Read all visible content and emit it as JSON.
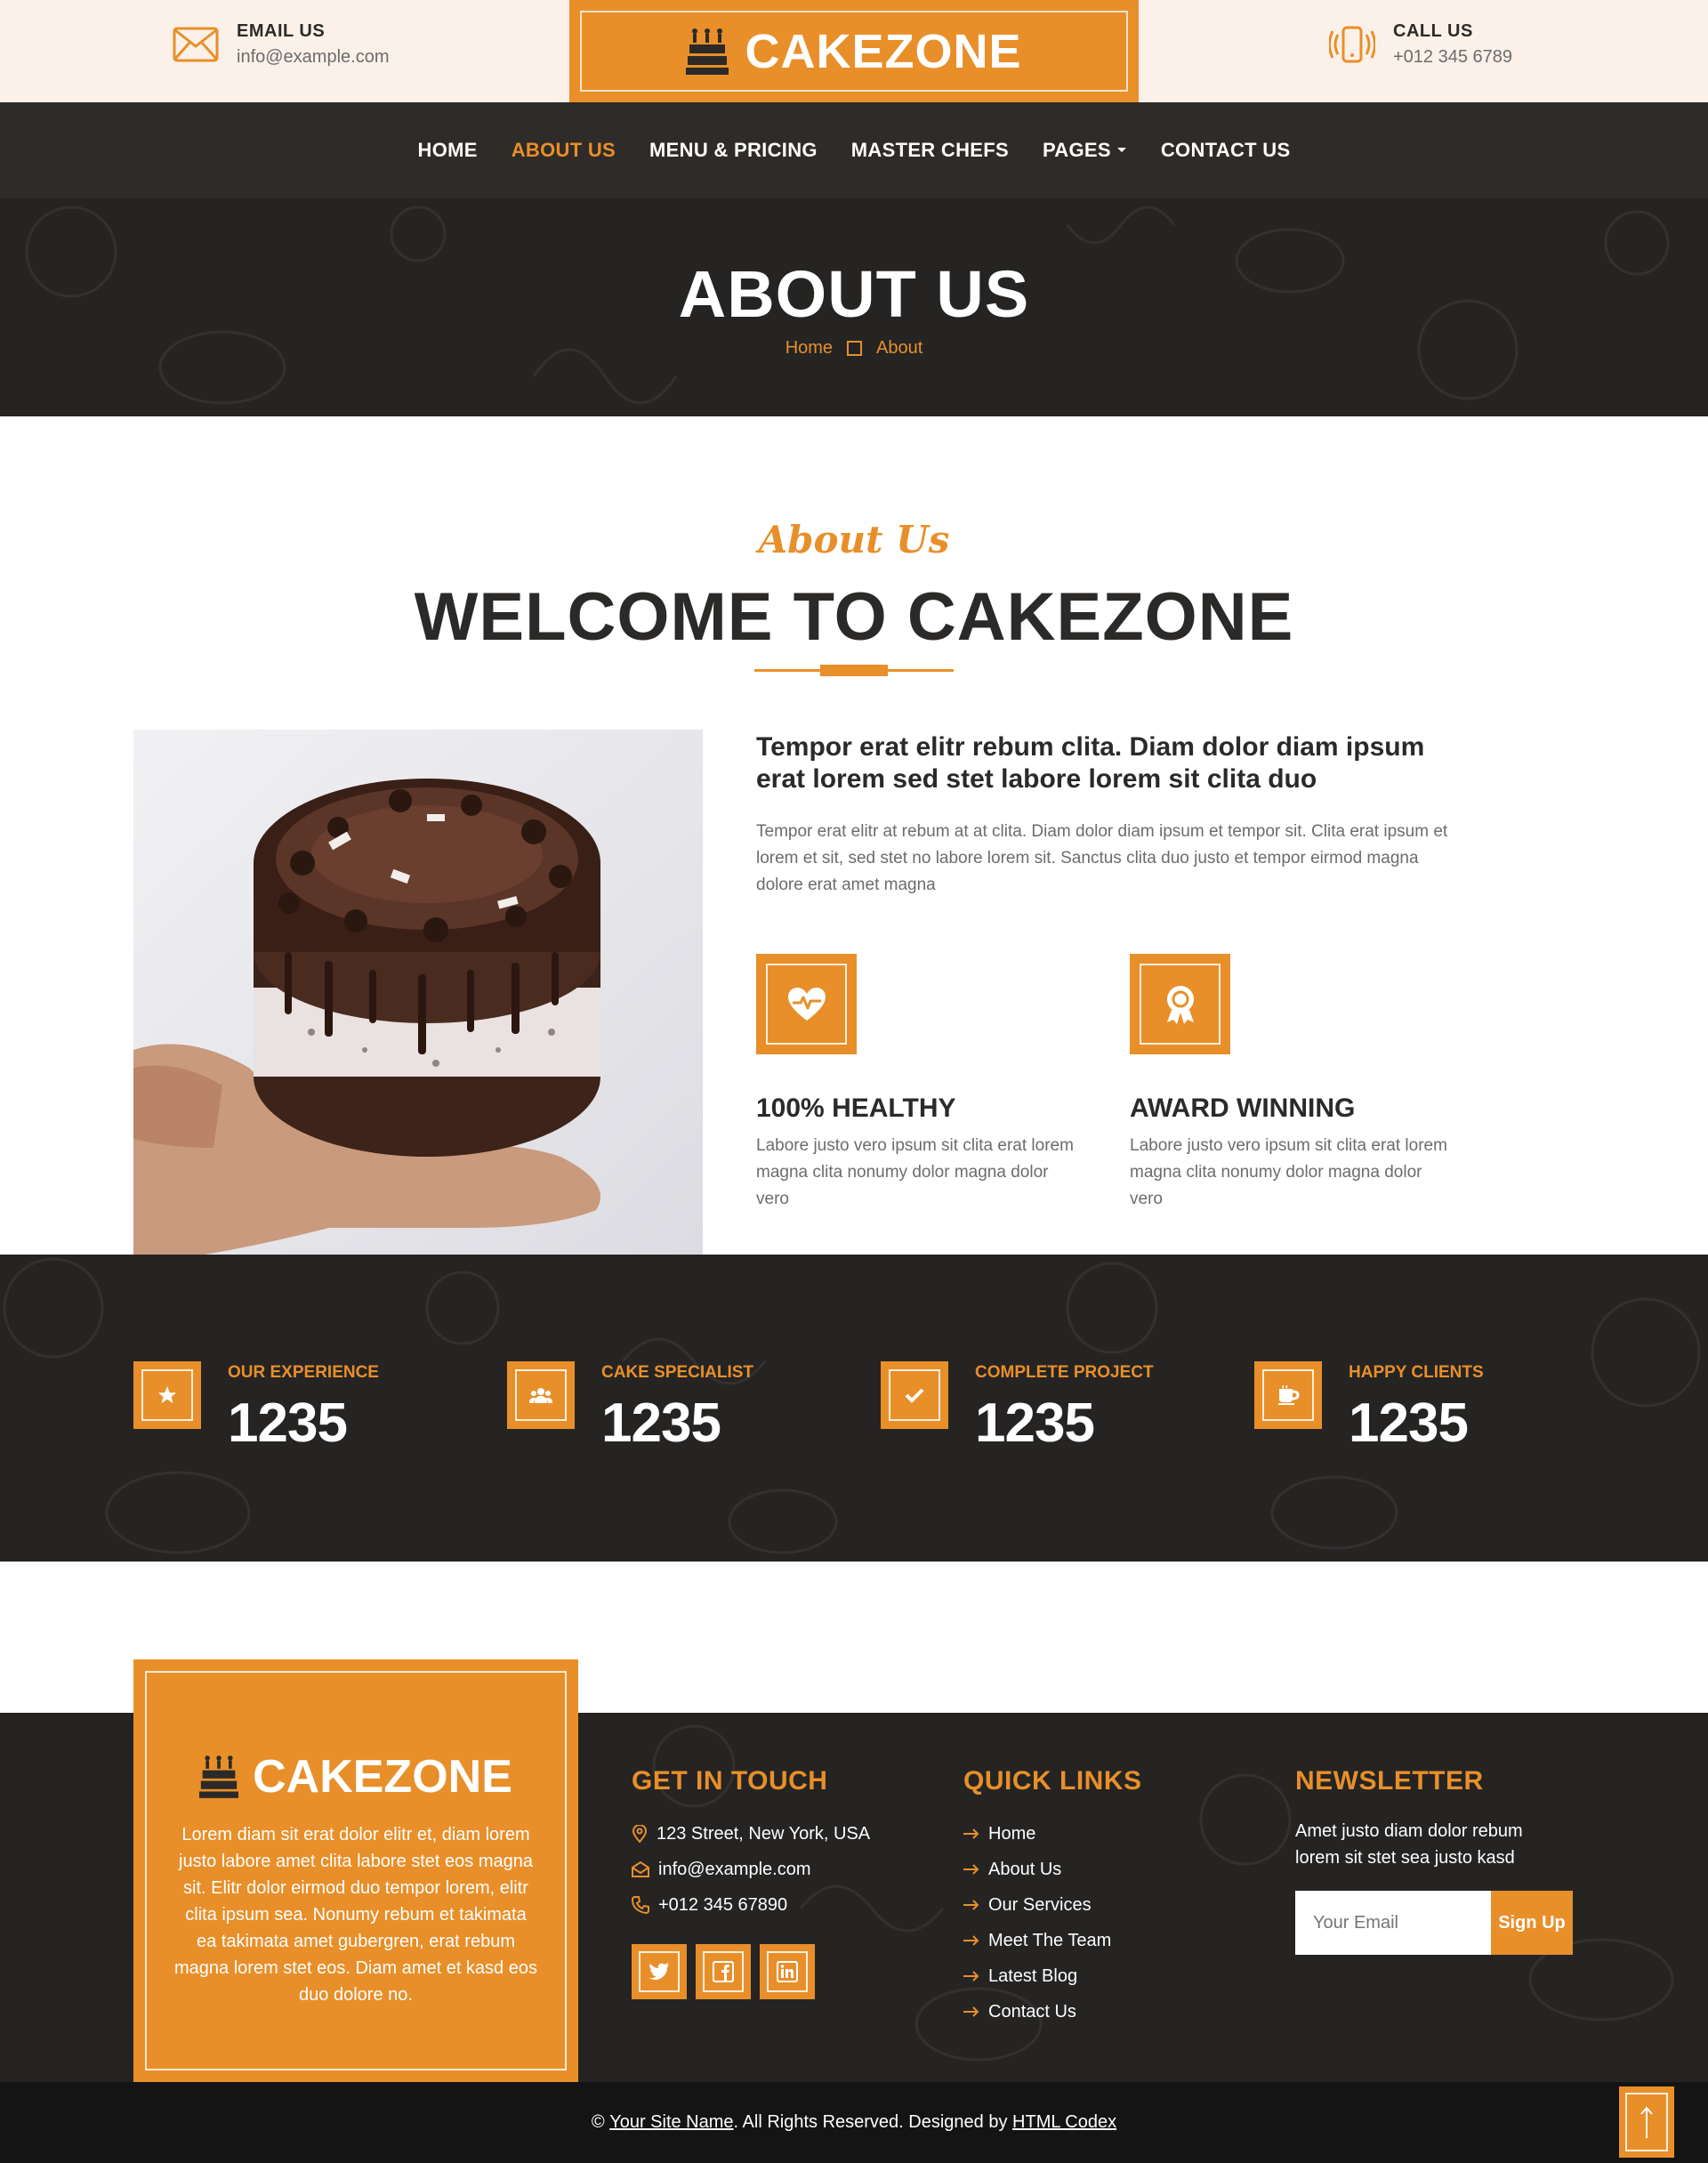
{
  "topbar": {
    "email_label": "EMAIL US",
    "email_value": "info@example.com",
    "brand": "CAKEZONE",
    "call_label": "CALL US",
    "call_value": "+012 345 6789"
  },
  "nav": {
    "items": [
      {
        "label": "HOME",
        "active": false
      },
      {
        "label": "ABOUT US",
        "active": true
      },
      {
        "label": "MENU & PRICING",
        "active": false
      },
      {
        "label": "MASTER CHEFS",
        "active": false
      },
      {
        "label": "PAGES",
        "active": false,
        "dropdown": true
      },
      {
        "label": "CONTACT US",
        "active": false
      }
    ]
  },
  "hero": {
    "title": "ABOUT US",
    "breadcrumb": [
      "Home",
      "About"
    ]
  },
  "about": {
    "subtitle": "About Us",
    "title": "WELCOME TO CAKEZONE",
    "lead": "Tempor erat elitr rebum clita. Diam dolor diam ipsum erat lorem sed stet labore lorem sit clita duo",
    "body": "Tempor erat elitr at rebum at at clita. Diam dolor diam ipsum et tempor sit. Clita erat ipsum et lorem et sit, sed stet no labore lorem sit. Sanctus clita duo justo et tempor eirmod magna dolore erat amet magna",
    "features": [
      {
        "icon": "heart-pulse-icon",
        "title": "100% HEALTHY",
        "text": "Labore justo vero ipsum sit clita erat lorem magna clita nonumy dolor magna dolor vero"
      },
      {
        "icon": "award-icon",
        "title": "AWARD WINNING",
        "text": "Labore justo vero ipsum sit clita erat lorem magna clita nonumy dolor magna dolor vero"
      }
    ]
  },
  "stats": [
    {
      "icon": "star-icon",
      "label": "OUR EXPERIENCE",
      "value": "1235"
    },
    {
      "icon": "users-icon",
      "label": "CAKE SPECIALIST",
      "value": "1235"
    },
    {
      "icon": "check-icon",
      "label": "COMPLETE PROJECT",
      "value": "1235"
    },
    {
      "icon": "mug-icon",
      "label": "HAPPY CLIENTS",
      "value": "1235"
    }
  ],
  "footer": {
    "brand": "CAKEZONE",
    "description": "Lorem diam sit erat dolor elitr et, diam lorem justo labore amet clita labore stet eos magna sit. Elitr dolor eirmod duo tempor lorem, elitr clita ipsum sea. Nonumy rebum et takimata ea takimata amet gubergren, erat rebum magna lorem stet eos. Diam amet et kasd eos duo dolore no.",
    "get_in_touch": {
      "title": "GET IN TOUCH",
      "address": "123 Street, New York, USA",
      "email": "info@example.com",
      "phone": "+012 345 67890"
    },
    "quick_links": {
      "title": "QUICK LINKS",
      "items": [
        "Home",
        "About Us",
        "Our Services",
        "Meet The Team",
        "Latest Blog",
        "Contact Us"
      ]
    },
    "newsletter": {
      "title": "NEWSLETTER",
      "text": "Amet justo diam dolor rebum lorem sit stet sea justo kasd",
      "placeholder": "Your Email",
      "button": "Sign Up"
    },
    "copyright_prefix": "©",
    "site_name": "Your Site Name",
    "rights": ". All Rights Reserved. Designed by",
    "designer": "HTML Codex"
  },
  "colors": {
    "accent": "#E88F2A",
    "dark": "#252423",
    "nav": "#2F2B28",
    "topbar": "#FBF1E9"
  }
}
